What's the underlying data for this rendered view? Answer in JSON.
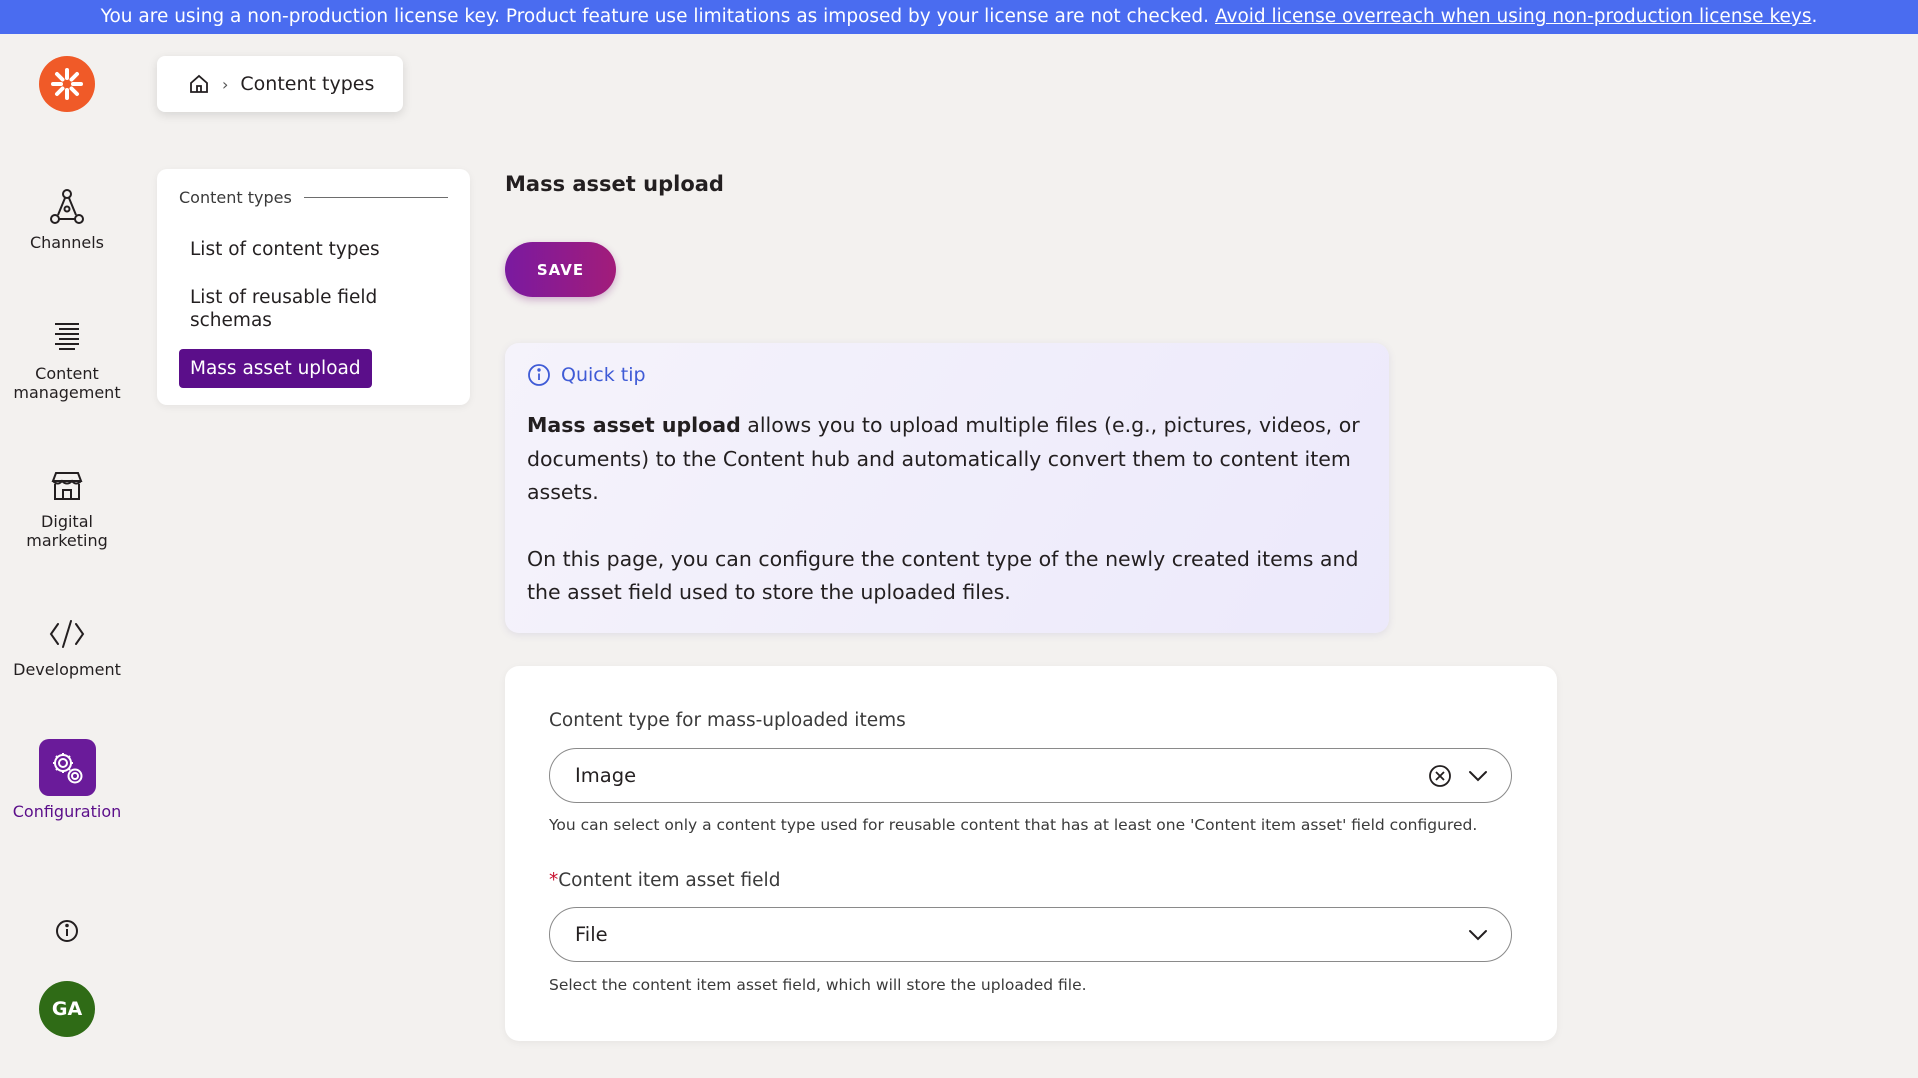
{
  "banner": {
    "text": "You are using a non-production license key. Product feature use limitations as imposed by your license are not checked.",
    "link": "Avoid license overreach when using non-production license keys",
    "trailing": "."
  },
  "rail": {
    "items": [
      {
        "label": "Channels",
        "icon": "channels-icon"
      },
      {
        "label": "Content management",
        "icon": "content-management-icon"
      },
      {
        "label": "Digital marketing",
        "icon": "storefront-icon"
      },
      {
        "label": "Development",
        "icon": "code-icon"
      },
      {
        "label": "Configuration",
        "icon": "gear-icon",
        "active": true
      }
    ],
    "avatar_initials": "GA"
  },
  "breadcrumb": {
    "current": "Content types"
  },
  "subnav": {
    "heading": "Content types",
    "items": [
      {
        "label": "List of content types"
      },
      {
        "label": "List of reusable field schemas"
      },
      {
        "label": "Mass asset upload",
        "active": true
      }
    ]
  },
  "main": {
    "title": "Mass asset upload",
    "save_label": "SAVE",
    "tip": {
      "heading": "Quick tip",
      "bold": "Mass asset upload",
      "p1_rest": " allows you to upload multiple files (e.g., pictures, videos, or documents) to the Content hub and automatically convert them to content item assets.",
      "p2": "On this page, you can configure the content type of the newly created items and the asset field used to store the uploaded files."
    },
    "form": {
      "content_type": {
        "label": "Content type for mass-uploaded items",
        "value": "Image",
        "hint": "You can select only a content type used for reusable content that has at least one 'Content item asset' field configured."
      },
      "asset_field": {
        "required_mark": "*",
        "label": "Content item asset field",
        "value": "File",
        "hint": "Select the content item asset field, which will store the uploaded file."
      }
    }
  },
  "colors": {
    "banner": "#4a6cf0",
    "accent": "#5b0e8a",
    "logo": "#f05a28",
    "avatar": "#2f6b16",
    "tip_heading": "#3f5bd6"
  }
}
